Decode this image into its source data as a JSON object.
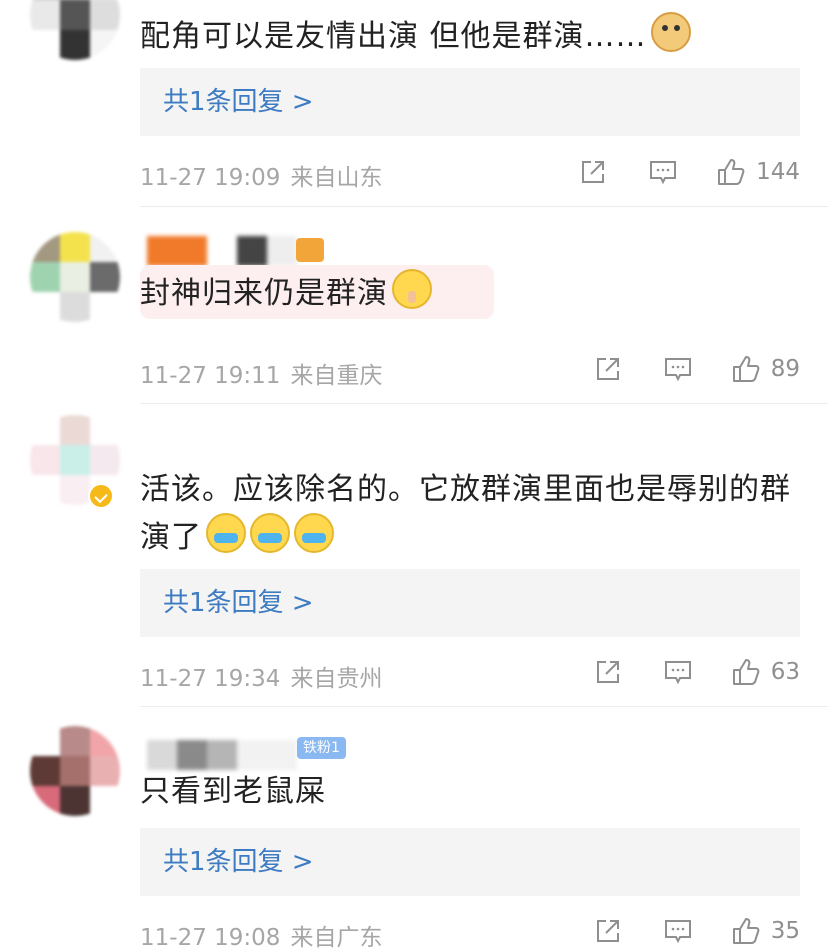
{
  "comments": [
    {
      "text": "配角可以是友情出演   但他是群演……",
      "emoji": "doge-emoji",
      "reply_label": "共1条回复 >",
      "time": "11-27 19:09",
      "location": "来自山东",
      "likes": "144"
    },
    {
      "text": "封神归来仍是群演",
      "emoji": "shh-emoji",
      "time": "11-27 19:11",
      "location": "来自重庆",
      "likes": "89"
    },
    {
      "text_line1": "活该。应该除名的。它放群演里面也是辱别的群",
      "text_line2": "演了",
      "emoji": "laugh-cry-emoji",
      "reply_label": "共1条回复 >",
      "time": "11-27 19:34",
      "location": "来自贵州",
      "likes": "63"
    },
    {
      "text": "只看到老鼠屎",
      "badge": "铁粉1",
      "reply_label": "共1条回复 >",
      "time": "11-27 19:08",
      "location": "来自广东",
      "likes": "35"
    }
  ],
  "icons": {
    "share": "share-icon",
    "comment": "comment-icon",
    "like": "thumbs-up-icon"
  },
  "colors": {
    "reply_link": "#3d7bc2",
    "meta_text": "#a6a6a6",
    "reply_bg": "#f4f4f4"
  }
}
